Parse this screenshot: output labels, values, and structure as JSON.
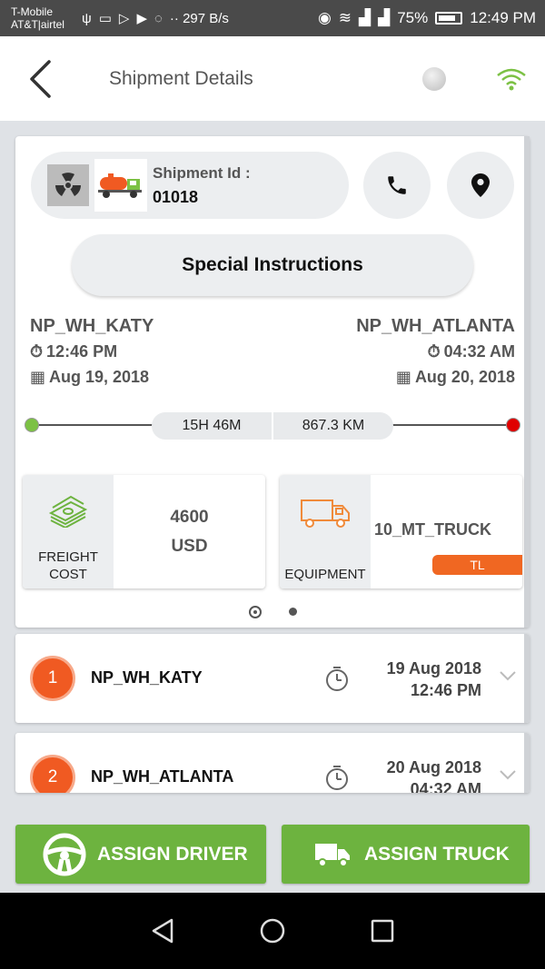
{
  "status_bar": {
    "carrier_line1": "T-Mobile",
    "carrier_line2": "AT&T|airtel",
    "speed": "·· 297 B/s",
    "battery": "75%",
    "time": "12:49 PM"
  },
  "header": {
    "title": "Shipment Details",
    "back_icon": "arrow-left-icon",
    "wifi_icon": "wifi-icon",
    "accent_color": "#6db33f"
  },
  "shipment": {
    "id_label": "Shipment Id :",
    "id_value": "01018",
    "special_instructions": "Special Instructions"
  },
  "route": {
    "origin": {
      "name": "NP_WH_KATY",
      "time": "12:46 PM",
      "date": "Aug 19, 2018"
    },
    "destination": {
      "name": "NP_WH_ATLANTA",
      "time": "04:32 AM",
      "date": "Aug 20, 2018"
    },
    "duration": "15H 46M",
    "distance": "867.3  KM",
    "start_color": "#7cc144",
    "end_color": "#e00000"
  },
  "freight": {
    "label_line1": "FREIGHT",
    "label_line2": "COST",
    "amount": "4600",
    "currency": "USD"
  },
  "equipment": {
    "label": "EQUIPMENT",
    "name": "10_MT_TRUCK",
    "badge": "TL",
    "badge_color": "#f06722"
  },
  "stops": [
    {
      "number": "1",
      "name": "NP_WH_KATY",
      "date": "19 Aug 2018",
      "time": "12:46 PM"
    },
    {
      "number": "2",
      "name": "NP_WH_ATLANTA",
      "date": "20 Aug 2018",
      "time": "04:32 AM"
    }
  ],
  "actions": {
    "assign_driver": "ASSIGN DRIVER",
    "assign_truck": "ASSIGN TRUCK"
  }
}
